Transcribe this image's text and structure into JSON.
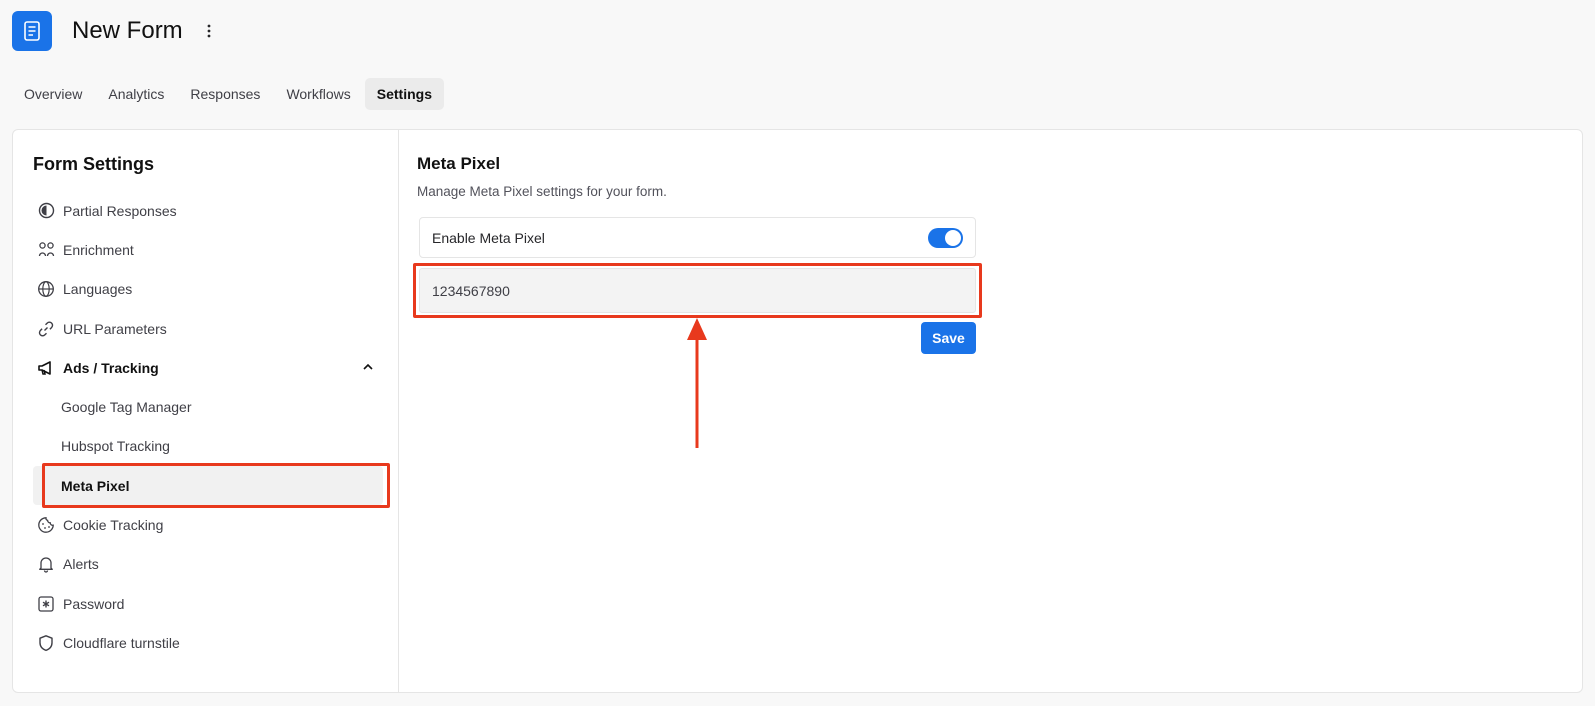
{
  "header": {
    "title": "New Form",
    "app_icon": "document-icon",
    "more_icon": "vertical-ellipsis-icon",
    "accent_color": "#1a73e8"
  },
  "tabs": [
    {
      "label": "Overview"
    },
    {
      "label": "Analytics"
    },
    {
      "label": "Responses"
    },
    {
      "label": "Workflows"
    },
    {
      "label": "Settings",
      "active": true
    }
  ],
  "sidebar": {
    "title": "Form Settings",
    "items": [
      {
        "label": "Partial Responses",
        "icon": "half-circle-icon"
      },
      {
        "label": "Enrichment",
        "icon": "users-icon"
      },
      {
        "label": "Languages",
        "icon": "globe-icon"
      },
      {
        "label": "URL Parameters",
        "icon": "link-icon"
      },
      {
        "label": "Ads / Tracking",
        "icon": "megaphone-icon",
        "expanded": true
      },
      {
        "label": "Google Tag Manager"
      },
      {
        "label": "Hubspot Tracking"
      },
      {
        "label": "Meta Pixel",
        "active": true
      },
      {
        "label": "Cookie Tracking",
        "icon": "cookie-icon"
      },
      {
        "label": "Alerts",
        "icon": "bell-icon"
      },
      {
        "label": "Password",
        "icon": "asterisk-icon"
      },
      {
        "label": "Cloudflare turnstile",
        "icon": "shield-icon"
      }
    ]
  },
  "main": {
    "title": "Meta Pixel",
    "description": "Manage Meta Pixel settings for your form.",
    "toggle_label": "Enable Meta Pixel",
    "toggle_on": true,
    "pixel_id_value": "1234567890",
    "save_label": "Save"
  },
  "annotations": {
    "highlight_color": "#e8391d"
  }
}
